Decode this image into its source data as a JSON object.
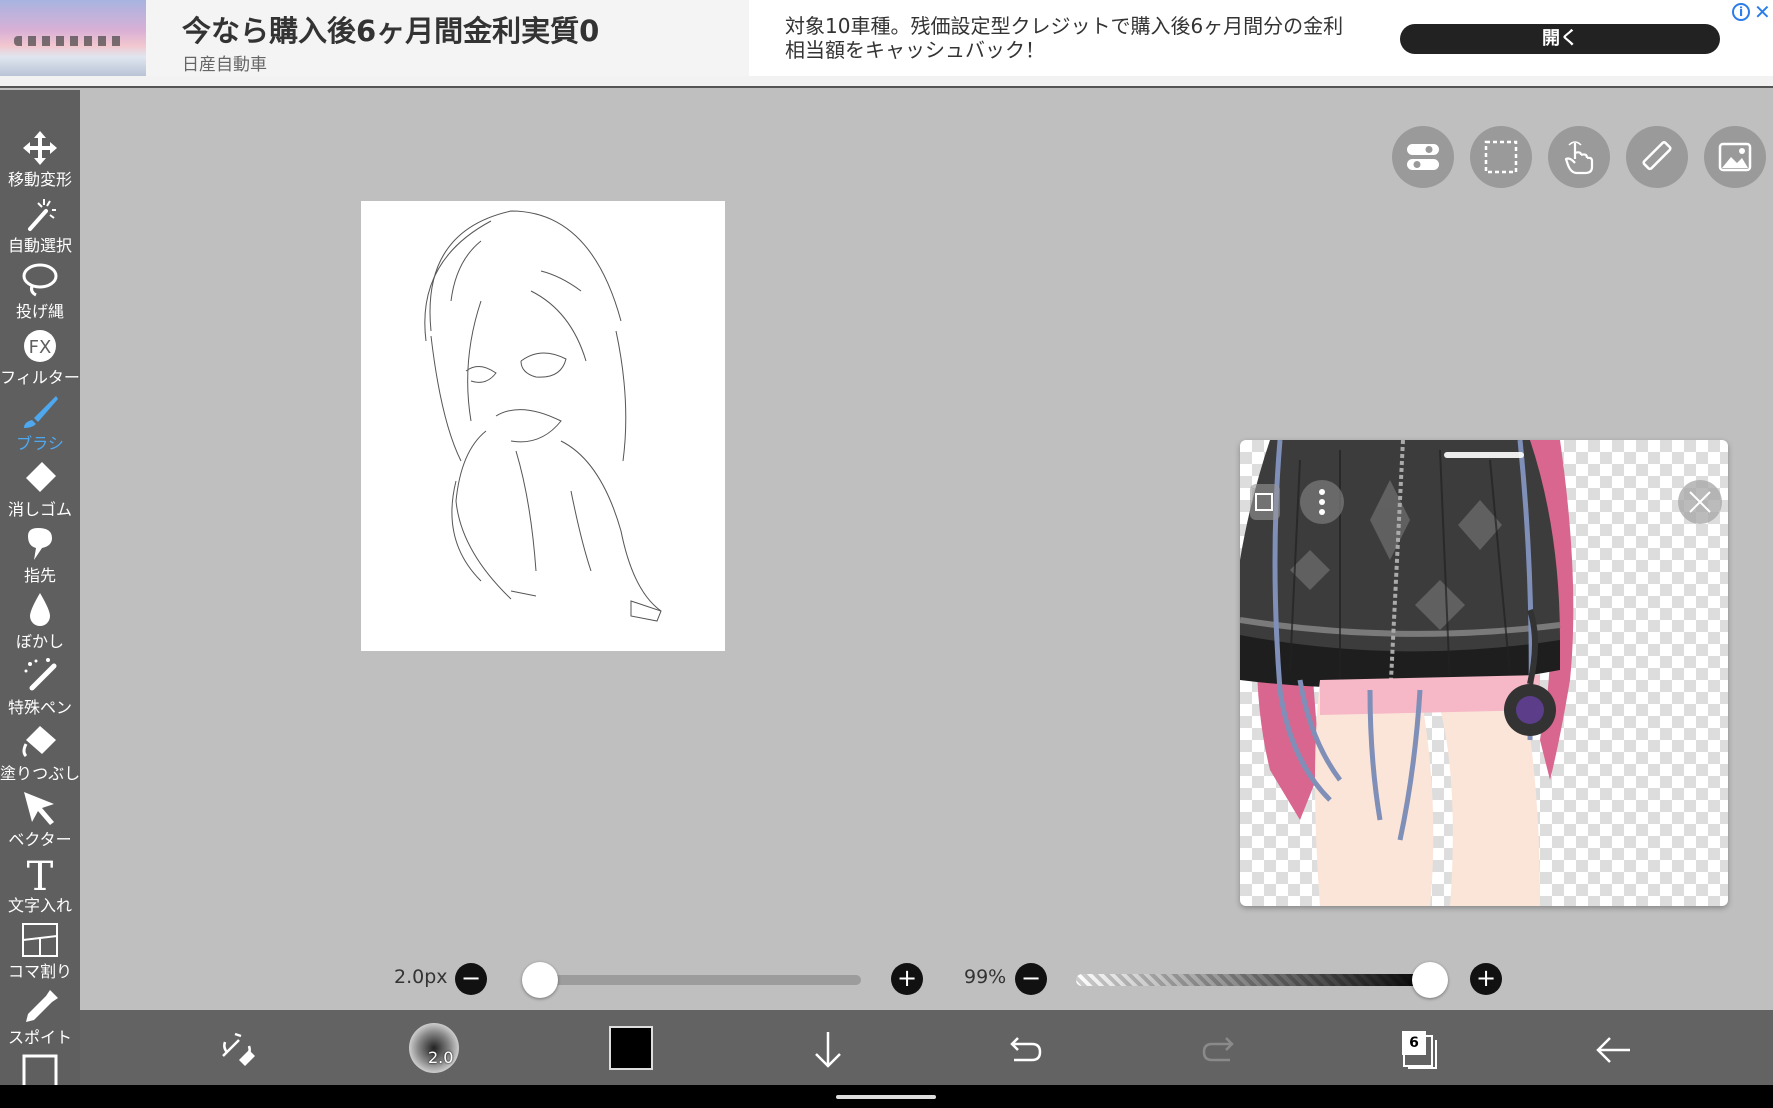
{
  "ad": {
    "title": "今なら購入後6ヶ月間金利実質0",
    "brand": "日産自動車",
    "description": "対象10車種。残価設定型クレジットで購入後6ヶ月間分の金利相当額をキャッシュバック！",
    "open_label": "開く",
    "info_label": "i",
    "close_label": "✕"
  },
  "toolbar": {
    "active": "brush",
    "items": [
      {
        "id": "move",
        "label": "移動変形",
        "icon": "move-arrows-icon"
      },
      {
        "id": "magic",
        "label": "自動選択",
        "icon": "magic-wand-icon"
      },
      {
        "id": "lasso",
        "label": "投げ縄",
        "icon": "lasso-icon"
      },
      {
        "id": "filter",
        "label": "フィルター",
        "icon": "fx-icon"
      },
      {
        "id": "brush",
        "label": "ブラシ",
        "icon": "brush-icon"
      },
      {
        "id": "eraser",
        "label": "消しゴム",
        "icon": "eraser-icon"
      },
      {
        "id": "finger",
        "label": "指先",
        "icon": "finger-icon"
      },
      {
        "id": "blur",
        "label": "ぼかし",
        "icon": "drop-icon"
      },
      {
        "id": "special",
        "label": "特殊ペン",
        "icon": "special-pen-icon"
      },
      {
        "id": "fill",
        "label": "塗りつぶし",
        "icon": "fill-bucket-icon"
      },
      {
        "id": "vector",
        "label": "ベクター",
        "icon": "cursor-arrow-icon"
      },
      {
        "id": "text",
        "label": "文字入れ",
        "icon": "text-icon"
      },
      {
        "id": "frame",
        "label": "コマ割り",
        "icon": "frame-divider-icon"
      },
      {
        "id": "eyedropper",
        "label": "スポイト",
        "icon": "eyedropper-icon"
      }
    ],
    "fx_label": "FX",
    "text_glyph": "T"
  },
  "sliders": {
    "brush_size_label": "2.0px",
    "brush_size_fraction": 0.04,
    "opacity_label": "99%",
    "opacity_fraction": 0.99,
    "minus": "−",
    "plus": "+"
  },
  "bottom": {
    "brush_size_text": "2.0",
    "color": "#000000",
    "layer_count": "6"
  },
  "colors": {
    "accent": "#4ea8f0",
    "toolbar_bg": "#5f5f5f",
    "canvas_bg": "#bfbfbf"
  }
}
